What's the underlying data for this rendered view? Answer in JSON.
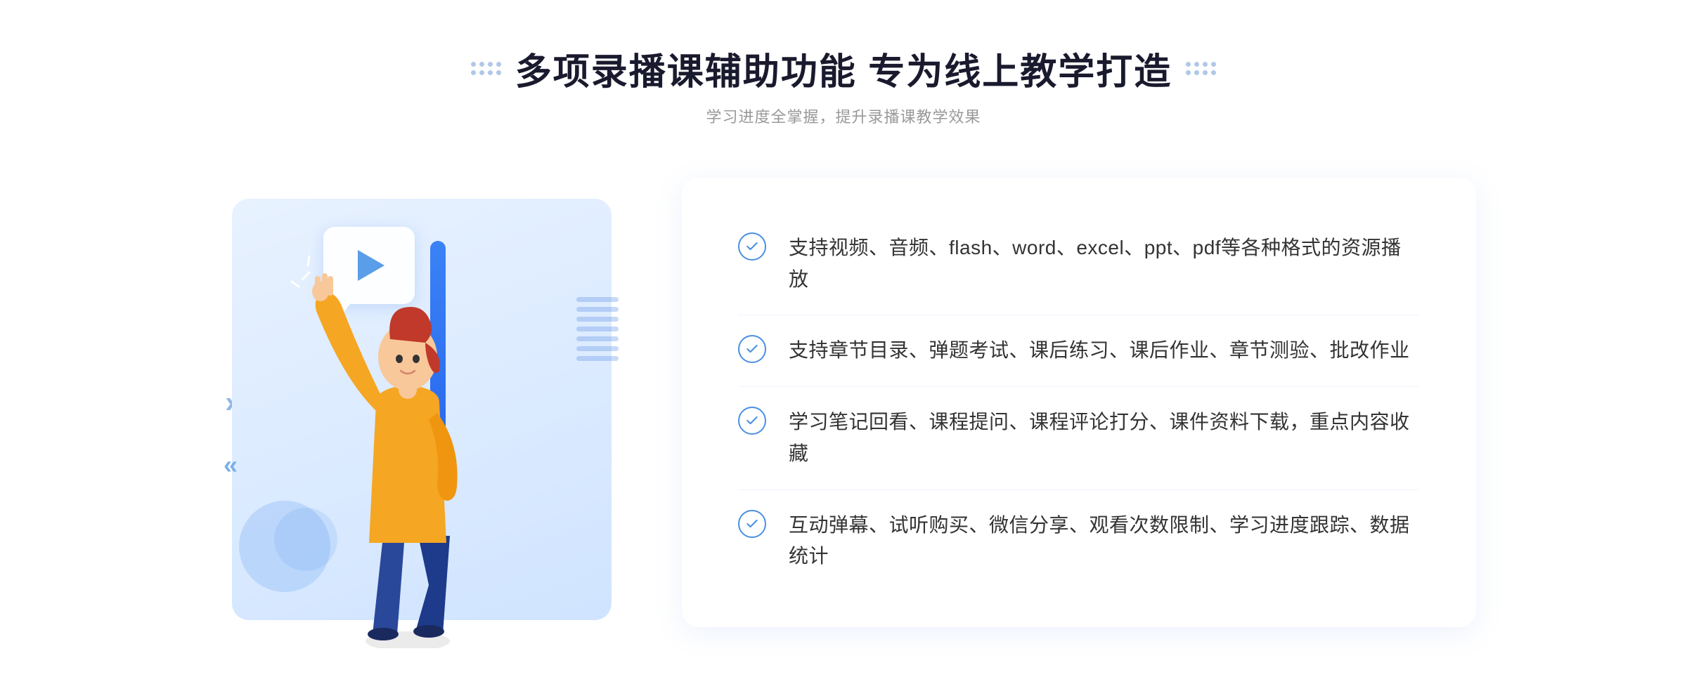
{
  "header": {
    "title": "多项录播课辅助功能 专为线上教学打造",
    "subtitle": "学习进度全掌握，提升录播课教学效果"
  },
  "features": [
    {
      "id": "feature-1",
      "text": "支持视频、音频、flash、word、excel、ppt、pdf等各种格式的资源播放"
    },
    {
      "id": "feature-2",
      "text": "支持章节目录、弹题考试、课后练习、课后作业、章节测验、批改作业"
    },
    {
      "id": "feature-3",
      "text": "学习笔记回看、课程提问、课程评论打分、课件资料下载，重点内容收藏"
    },
    {
      "id": "feature-4",
      "text": "互动弹幕、试听购买、微信分享、观看次数限制、学习进度跟踪、数据统计"
    }
  ],
  "decoration": {
    "left_arrows": "»",
    "deco_arrows": "«"
  }
}
